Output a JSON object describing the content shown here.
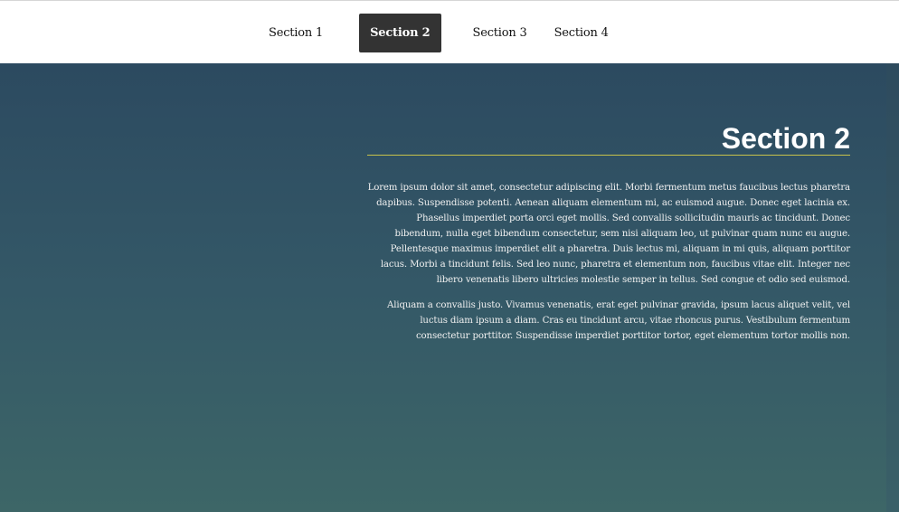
{
  "nav": {
    "tabs": [
      {
        "label": "Section 1",
        "active": false
      },
      {
        "label": "Section 2",
        "active": true
      },
      {
        "label": "Section 3",
        "active": false
      },
      {
        "label": "Section 4",
        "active": false
      }
    ]
  },
  "main": {
    "title": "Section 2",
    "paragraphs": [
      "Lorem ipsum dolor sit amet, consectetur adipiscing elit. Morbi fermentum metus faucibus lectus pharetra dapibus. Suspendisse potenti. Aenean aliquam elementum mi, ac euismod augue. Donec eget lacinia ex. Phasellus imperdiet porta orci eget mollis. Sed convallis sollicitudin mauris ac tincidunt. Donec bibendum, nulla eget bibendum consectetur, sem nisi aliquam leo, ut pulvinar quam nunc eu augue. Pellentesque maximus imperdiet elit a pharetra. Duis lectus mi, aliquam in mi quis, aliquam porttitor lacus. Morbi a tincidunt felis. Sed leo nunc, pharetra et elementum non, faucibus vitae elit. Integer nec libero venenatis libero ultricies molestie semper in tellus. Sed congue et odio sed euismod.",
      "Aliquam a convallis justo. Vivamus venenatis, erat eget pulvinar gravida, ipsum lacus aliquet velit, vel luctus diam ipsum a diam. Cras eu tincidunt arcu, vitae rhoncus purus. Vestibulum fermentum consectetur porttitor. Suspendisse imperdiet porttitor tortor, eget elementum tortor mollis non."
    ]
  },
  "colors": {
    "active_tab_bg": "#333333",
    "hero_gradient_top": "#2c4a60",
    "hero_gradient_bottom": "#3d6667",
    "title_rule": "#c8c24a"
  }
}
